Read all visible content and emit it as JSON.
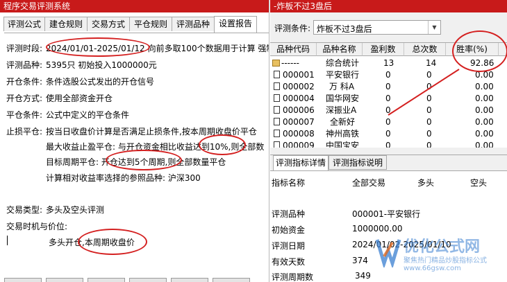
{
  "left": {
    "title": "程序交易评测系统",
    "tabs": [
      "评测公式",
      "建仓规则",
      "交易方式",
      "平仓规则",
      "评测品种",
      "设置报告"
    ],
    "active_tab": 5,
    "report": {
      "period_label": "评测时段:",
      "period_value": "2024/01/01-2025/01/12",
      "period_extra": "向前多取100个数据用于计算 强制",
      "variety_label": "评测品种:",
      "variety_value": "5395只 初始投入1000000元",
      "open_cond_label": "开仓条件:",
      "open_cond_value": "条件选股公式发出的开仓信号",
      "open_mode_label": "开仓方式:",
      "open_mode_value": "使用全部资金开仓",
      "close_cond_label": "平仓条件:",
      "close_cond_value": "公式中定义的平仓条件",
      "stop_label": "止损平仓:",
      "stop_line1": "按当日收盘价计算是否满足止损条件,按本周期收盘价平仓",
      "stop_line2_a": "最大收益止盈平仓: 与开仓资金相比收益",
      "stop_line2_b": "达到10%,",
      "stop_line2_c": "则全部数",
      "stop_line3_a": "目标周期平仓: ",
      "stop_line3_b": "开仓达到5个周期,",
      "stop_line3_c": "则全部数量平仓",
      "stop_line4": "计算相对收益率选择的参照品种: 沪深300",
      "trade_type_label": "交易类型:",
      "trade_type_value": "多头及空头评测",
      "timing_label": "交易时机与价位:",
      "timing_line": "多头开仓,本周期收盘价"
    }
  },
  "right": {
    "title": "-炸板不过3盘后",
    "condition_label": "评测条件:",
    "condition_value": "炸板不过3盘后",
    "columns": [
      "品种代码",
      "品种名称",
      "盈利数",
      "总次数",
      "胜率(%)"
    ],
    "rows": [
      {
        "code": "------",
        "name": "综合统计",
        "win": "13",
        "total": "14",
        "rate": "92.86"
      },
      {
        "code": "000001",
        "name": "平安银行",
        "win": "0",
        "total": "0",
        "rate": "0.00"
      },
      {
        "code": "000002",
        "name": "万 科A",
        "win": "0",
        "total": "0",
        "rate": "0.00"
      },
      {
        "code": "000004",
        "name": "国华网安",
        "win": "0",
        "total": "0",
        "rate": "0.00"
      },
      {
        "code": "000006",
        "name": "深振业A",
        "win": "0",
        "total": "0",
        "rate": "0.00"
      },
      {
        "code": "000007",
        "name": "全新好",
        "win": "0",
        "total": "0",
        "rate": "0.00"
      },
      {
        "code": "000008",
        "name": "神州高铁",
        "win": "0",
        "total": "0",
        "rate": "0.00"
      },
      {
        "code": "000009",
        "name": "中国宝安",
        "win": "0",
        "total": "0",
        "rate": "0.00"
      }
    ],
    "lower_tabs": [
      "评测指标详情",
      "评测指标说明"
    ],
    "detail_headers": [
      "指标名称",
      "全部交易",
      "多头",
      "空头"
    ],
    "details": [
      {
        "name": "评测品种",
        "value": "000001-平安银行"
      },
      {
        "name": "初始资金",
        "value": "1000000.00"
      },
      {
        "name": "评测日期",
        "value": "2024/01/02-2025/01/10"
      },
      {
        "name": "有效天数",
        "value": "374"
      },
      {
        "name": "评测周期数",
        "value": "349"
      }
    ]
  },
  "watermark": {
    "site": "优化公式网",
    "slogan": "聚焦热门精品炒股指标公式",
    "url": "www.66gsw.com"
  },
  "colors": {
    "titlebar": "#c81a1a",
    "annotation": "#d42020"
  }
}
